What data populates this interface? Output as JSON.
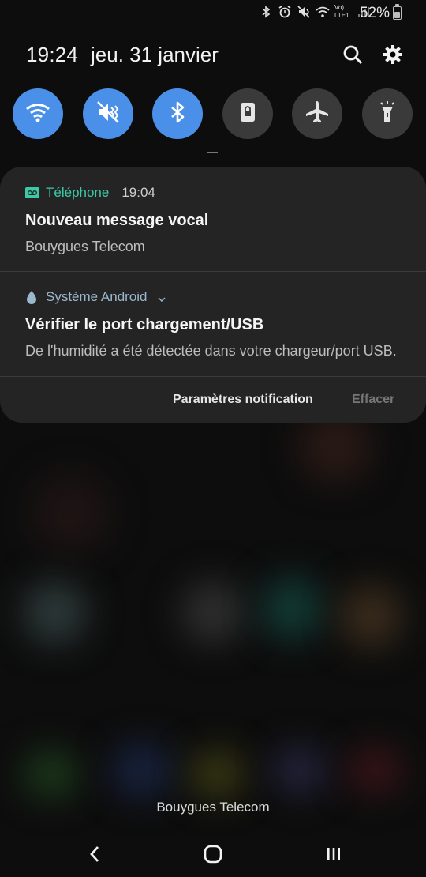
{
  "status_bar": {
    "battery_percent": "52%",
    "battery_level": 0.52,
    "icons": [
      "bluetooth-icon",
      "alarm-icon",
      "vibrate-icon",
      "wifi-icon",
      "volte-lte-icon",
      "signal-icon",
      "battery-icon"
    ],
    "volte_label": "Vo)",
    "lte_label": "LTE1"
  },
  "header": {
    "time": "19:24",
    "date": "jeu. 31 janvier"
  },
  "quick_settings": [
    {
      "name": "wifi",
      "state": "on"
    },
    {
      "name": "vibrate",
      "state": "on"
    },
    {
      "name": "bluetooth",
      "state": "on"
    },
    {
      "name": "rotation-lock",
      "state": "off"
    },
    {
      "name": "airplane-mode",
      "state": "off"
    },
    {
      "name": "flashlight",
      "state": "off"
    }
  ],
  "notifications": [
    {
      "app": "Téléphone",
      "time": "19:04",
      "title": "Nouveau message vocal",
      "body": "Bouygues Telecom",
      "app_color": "#3dc9a8"
    },
    {
      "app": "Système Android",
      "title": "Vérifier le port chargement/USB",
      "body": "De l'humidité a été détectée dans votre chargeur/port USB.",
      "app_color": "#9ab8cc"
    }
  ],
  "footer": {
    "settings_label": "Paramètres notification",
    "clear_label": "Effacer"
  },
  "carrier": "Bouygues Telecom",
  "colors": {
    "toggle_on": "#4a90e8",
    "toggle_off": "#3a3a3a",
    "panel_bg": "#242424"
  }
}
